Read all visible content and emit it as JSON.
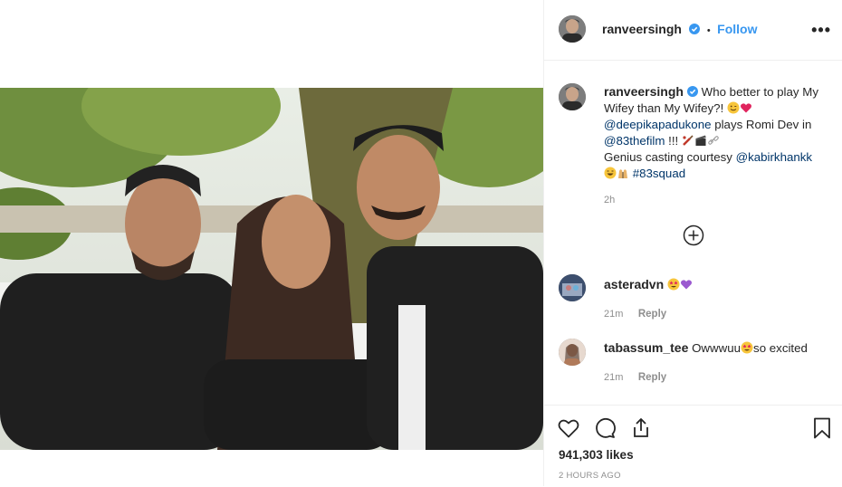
{
  "post": {
    "username": "ranveersingh",
    "follow_label": "Follow",
    "more_label": "•••",
    "caption_parts": {
      "line1": "Who better to play My Wifey than My Wifey?!",
      "mention1": "@deepikapadukone",
      "text2": " plays Romi Dev in ",
      "mention2": "@83thefilm",
      "text3": " !!! ",
      "text4": "Genius casting courtesy ",
      "mention3": "@kabirkhankk",
      "hashtag": "#83squad"
    },
    "caption_time": "2h",
    "likes": "941,303 likes",
    "time_ago": "2 HOURS AGO"
  },
  "comments": [
    {
      "user": "asteradvn",
      "text": "",
      "time": "21m",
      "reply": "Reply"
    },
    {
      "user": "tabassum_tee",
      "text": "Owwwuu",
      "text_after": "so excited",
      "time": "21m",
      "reply": "Reply"
    }
  ],
  "icons": {
    "verified": "verified-badge-icon",
    "more": "more-options-icon",
    "load_more": "load-more-comments-icon",
    "like": "heart-icon",
    "comment": "comment-icon",
    "share": "share-icon",
    "save": "bookmark-icon"
  },
  "colors": {
    "accent": "#3897f0",
    "link": "#003569",
    "muted": "#8e8e8e",
    "text": "#262626"
  }
}
